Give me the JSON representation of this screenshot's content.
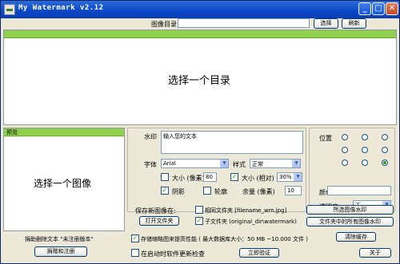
{
  "window": {
    "title": "My Watermark v2.12",
    "min_glyph": "_",
    "max_glyph": "□",
    "close_glyph": "✕"
  },
  "directory": {
    "label": "图像目录",
    "value": "",
    "browse_label": "选择",
    "refresh_label": "刷新"
  },
  "main_area": {
    "placeholder": "选择一个目录"
  },
  "preview": {
    "header": "预览",
    "placeholder": "选择一个图像",
    "donate_text": "捐助删除文本 \"未注册版本\"",
    "donate_button": "捐赠和注册"
  },
  "text_settings": {
    "watermark_label": "水印",
    "watermark_value": "输入您的文本",
    "font_label": "字体",
    "font_value": "Arial",
    "style_label": "样式",
    "style_value": "正常",
    "size_px_label": "大小 (像素)",
    "size_px_value": "80",
    "size_px_checked": false,
    "size_rel_label": "大小 (相对)",
    "size_rel_value": "30%",
    "size_rel_checked": true,
    "shadow_label": "阴影",
    "shadow_checked": true,
    "outline_label": "轮廓",
    "outline_checked": false,
    "margin_label": "余量 (像素)",
    "margin_value": "10"
  },
  "position": {
    "label": "位置",
    "grid": [
      [
        false,
        false,
        false
      ],
      [
        false,
        false,
        false
      ],
      [
        false,
        false,
        true
      ]
    ],
    "color_label": "颜色",
    "opacity_label": "透明度",
    "opacity_value": "无"
  },
  "save": {
    "label": "保存新图像在:",
    "open_folder": "打开文件夹",
    "same_folder": "相同文件夹 [filename_wm.jpg]",
    "same_folder_checked": false,
    "subfolder": "子文件夹 (original_dir\\watermark)",
    "subfolder_checked": true,
    "watermark_selected": "所选图像水印",
    "watermark_all": "文件夹中的所有图像水印"
  },
  "footer": {
    "cache_label": "存储缩略图来提高性能 ( 最大数据库大小：50 MB ~10.000 文件 )",
    "cache_checked": true,
    "clear_cache": "清除缓存",
    "update_label": "在启动时软件更新检查",
    "update_checked": false,
    "validate": "立即验证",
    "about": "关于"
  }
}
